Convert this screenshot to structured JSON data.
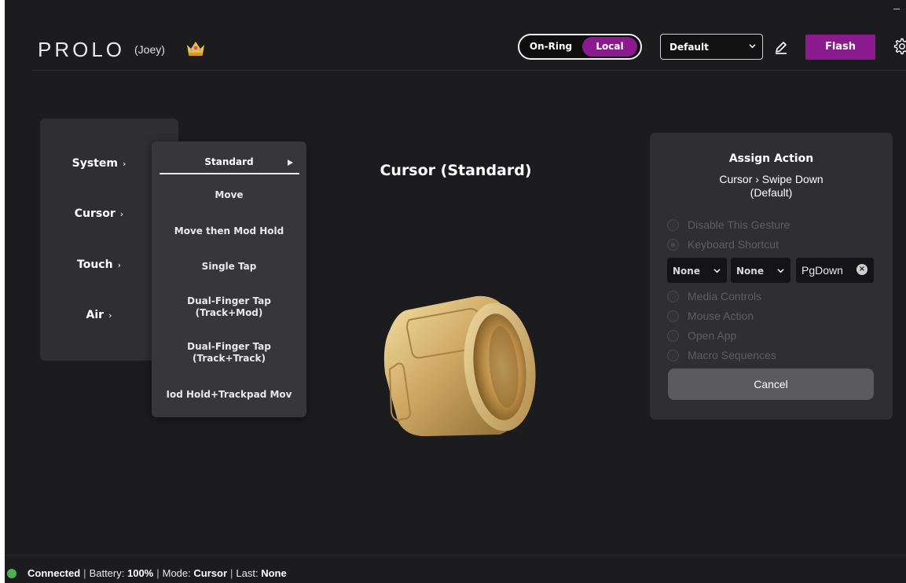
{
  "app": {
    "minimize_glyph": "–"
  },
  "header": {
    "logo": "PROLO",
    "username": "(Joey)",
    "crown_icon": "crown-icon",
    "mode_toggle": {
      "option_a": "On-Ring",
      "option_b": "Local",
      "selected": "Local"
    },
    "profile_select": {
      "value": "Default"
    },
    "flash_label": "Flash",
    "accent_color": "#8b1a8f"
  },
  "categories": [
    {
      "label": "System",
      "arrow": "›"
    },
    {
      "label": "Cursor",
      "arrow": "›"
    },
    {
      "label": "Touch",
      "arrow": "›"
    },
    {
      "label": "Air",
      "arrow": "›"
    }
  ],
  "submenu": {
    "items": [
      "Standard",
      "Move",
      "Move then Mod Hold",
      "Single Tap",
      "Dual-Finger Tap\n(Track+Mod)",
      "Dual-Finger Tap\n(Track+Track)",
      "Iod Hold+Trackpad Mov"
    ]
  },
  "center": {
    "title": "Cursor (Standard)"
  },
  "assign": {
    "title": "Assign Action",
    "path_line1": "Cursor › Swipe Down",
    "path_line2": "(Default)",
    "options": [
      "Disable This Gesture",
      "Keyboard Shortcut",
      "Media Controls",
      "Mouse Action",
      "Open App",
      "Macro Sequences"
    ],
    "selected_option": "Keyboard Shortcut",
    "modifier1": "None",
    "modifier2": "None",
    "key": "PgDown",
    "cancel_label": "Cancel"
  },
  "status": {
    "connected": "Connected",
    "battery_label": "Battery:",
    "battery_value": "100%",
    "mode_label": "Mode:",
    "mode_value": "Cursor",
    "last_label": "Last:",
    "last_value": "None",
    "separator": "|",
    "dot_color": "#4caf50"
  }
}
